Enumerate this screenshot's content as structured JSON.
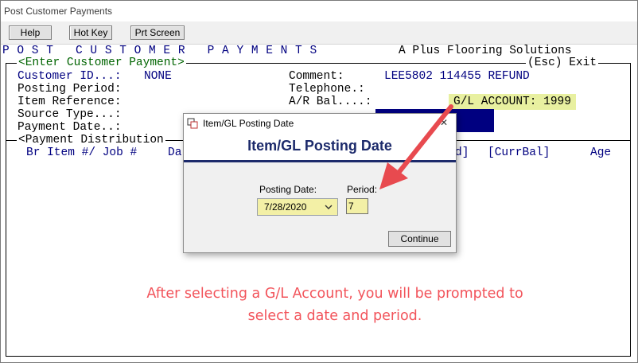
{
  "window": {
    "title": "Post Customer Payments"
  },
  "toolbar": {
    "help": "Help",
    "hotkey": "Hot Key",
    "prtscreen": "Prt Screen"
  },
  "term": {
    "heading": "P O S T   C U S T O M E R   P A Y M E N T S",
    "company": "A Plus Flooring Solutions",
    "frame_label": "<Enter Customer Payment>",
    "exit_label": "(Esc) Exit",
    "customer_id_label": "Customer ID...:",
    "customer_id_value": "NONE",
    "posting_period_label": "Posting Period:",
    "item_reference_label": "Item Reference:",
    "source_type_label": "Source Type...:",
    "payment_date_label": "Payment Date..:",
    "comment_label": "Comment:",
    "comment_value": "LEE5802 114455 REFUND",
    "telephone_label": "Telephone.:",
    "ar_bal_label": "A/R Bal....:",
    "gl_account": "G/L ACCOUNT: 1999",
    "distribution_label": "<Payment Distribution",
    "col_br_item": "Br Item #/ Job #",
    "col_da": "Da",
    "col_d": "d]",
    "col_currbal": "[CurrBal]",
    "col_age": "Age"
  },
  "dialog": {
    "title": "Item/GL Posting Date",
    "heading": "Item/GL Posting Date",
    "posting_date_label": "Posting Date:",
    "posting_date_value": "7/28/2020",
    "period_label": "Period:",
    "period_value": "7",
    "continue_label": "Continue",
    "close_glyph": "✕"
  },
  "annotation": {
    "line1": "After selecting a G/L Account, you will be prompted to",
    "line2": "select a date and period."
  },
  "colors": {
    "navy": "#000080",
    "green": "#006400",
    "annotation_red": "#f2545b",
    "arrow_red": "#e84a4f",
    "highlight_yellow": "#e8f0a0"
  }
}
